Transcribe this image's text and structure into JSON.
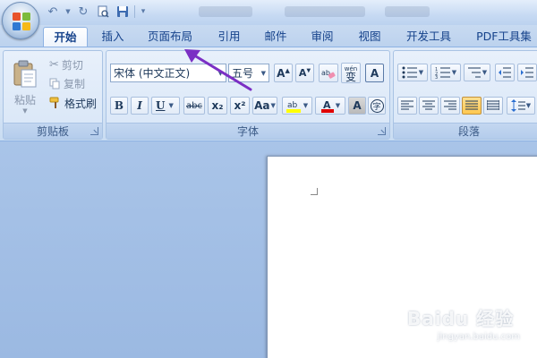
{
  "tabs": [
    {
      "label": "开始",
      "active": true
    },
    {
      "label": "插入"
    },
    {
      "label": "页面布局"
    },
    {
      "label": "引用"
    },
    {
      "label": "邮件"
    },
    {
      "label": "审阅"
    },
    {
      "label": "视图"
    },
    {
      "label": "开发工具"
    },
    {
      "label": "PDF工具集"
    }
  ],
  "clipboard": {
    "paste_label": "粘贴",
    "cut_label": "剪切",
    "copy_label": "复制",
    "format_painter_label": "格式刷",
    "group_label": "剪贴板"
  },
  "font": {
    "font_name": "宋体 (中文正文)",
    "font_size": "五号",
    "group_label": "字体",
    "phonetic_label": "wén",
    "phonetic_char": "变",
    "bold": "B",
    "italic": "I",
    "underline": "U",
    "strikethrough": "abc",
    "subscript": "x₂",
    "superscript": "x²",
    "change_case": "Aa",
    "font_color_letter": "A",
    "char_shading": "A",
    "enclose": "字"
  },
  "paragraph": {
    "group_label": "段落"
  },
  "colors": {
    "highlight": "#ffff00",
    "font_color": "#e00000",
    "arrow": "#7b2fc4"
  },
  "watermark": {
    "brand": "Baidu 经验",
    "url": "jingyan.baidu.com"
  }
}
